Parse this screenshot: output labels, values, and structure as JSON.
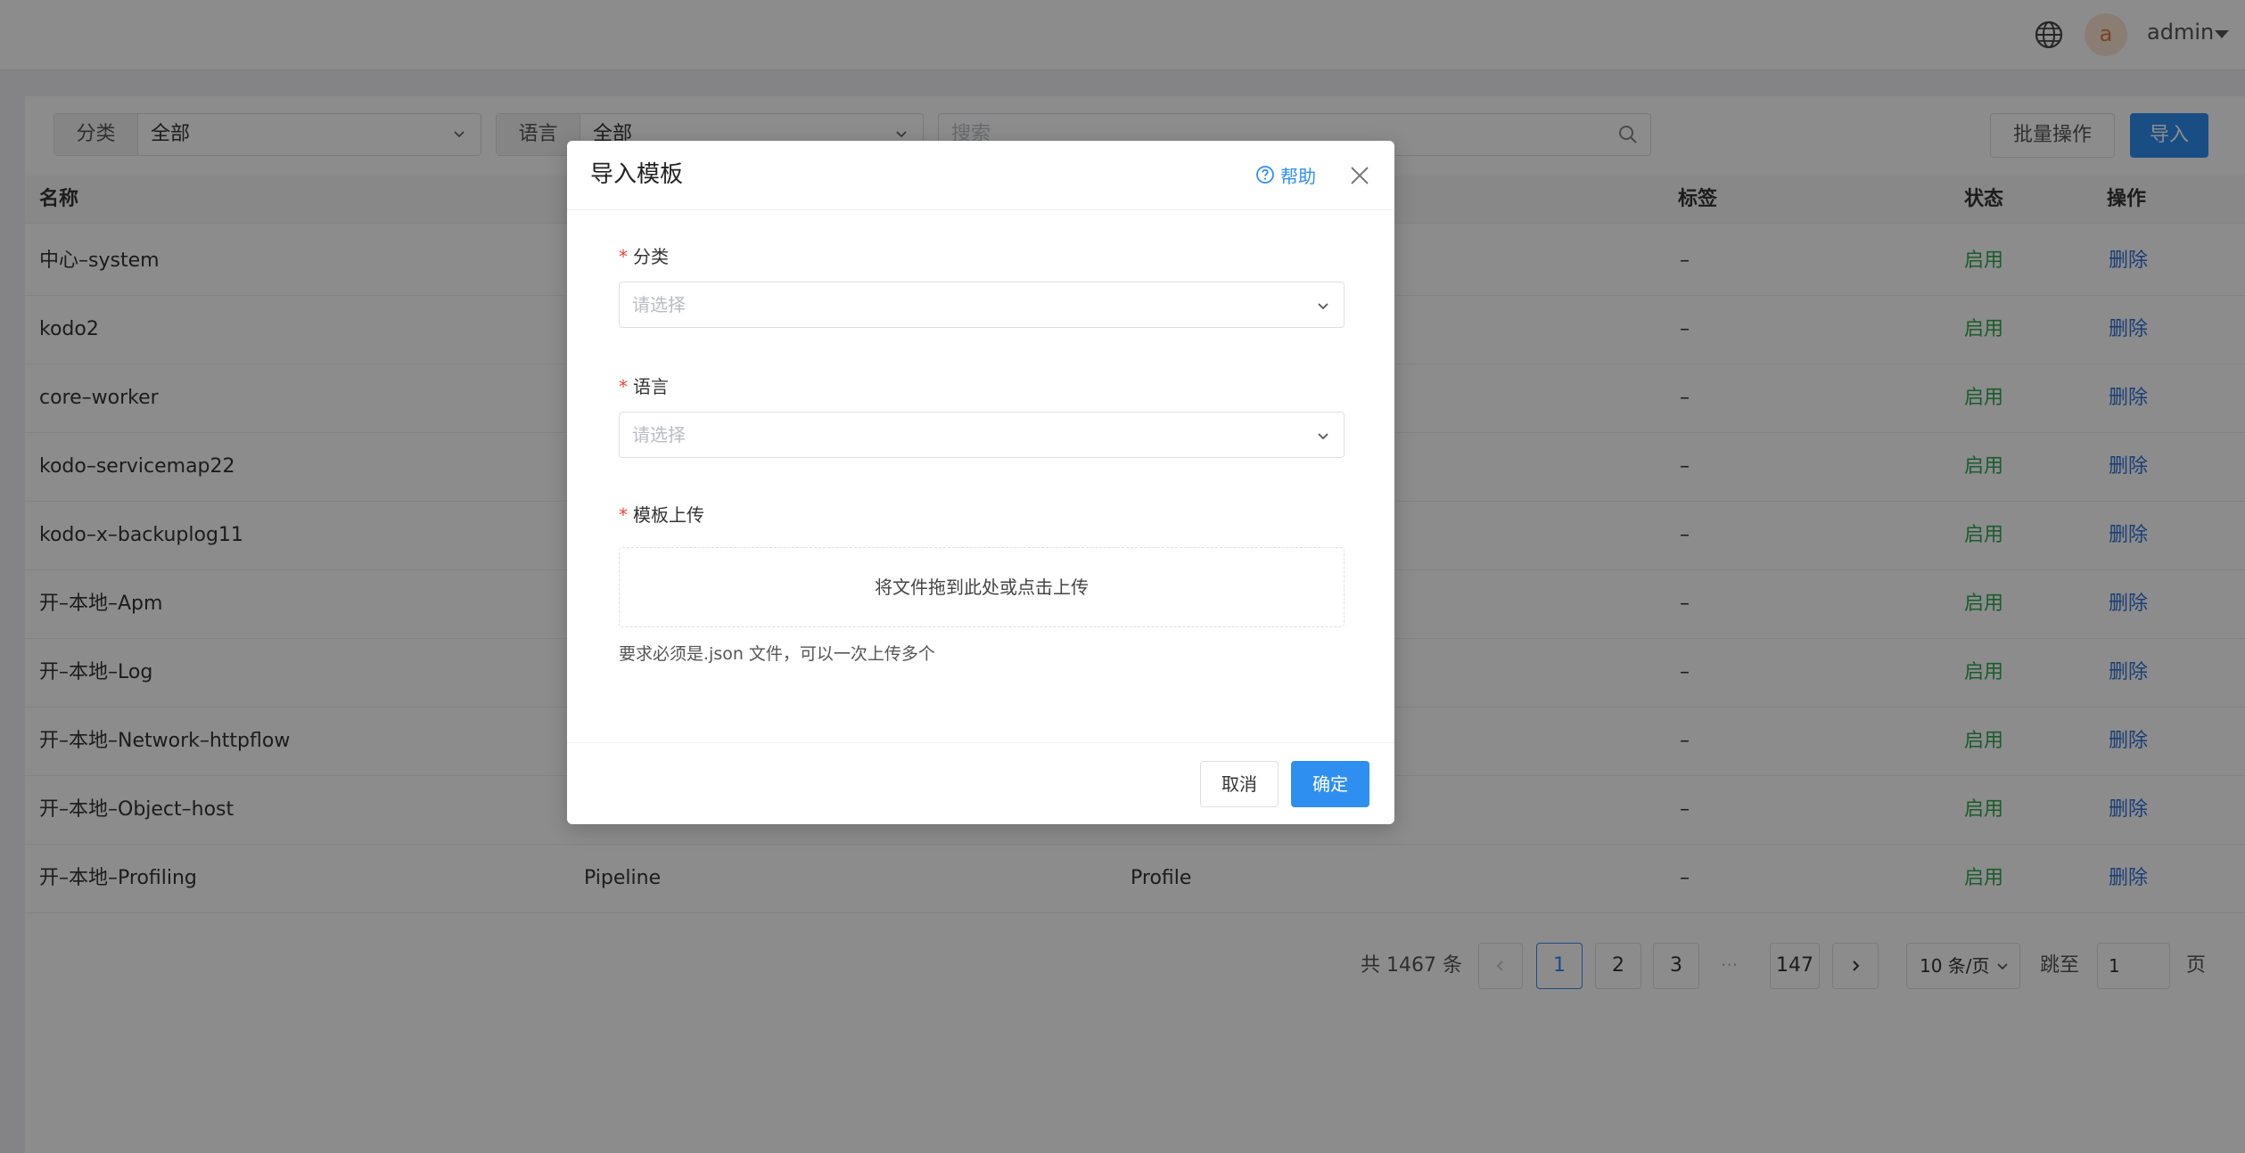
{
  "topbar": {
    "user_initial": "a",
    "username": "admin"
  },
  "filters": {
    "category": {
      "label": "分类",
      "value": "全部"
    },
    "language": {
      "label": "语言",
      "value": "全部"
    },
    "search_placeholder": "搜索"
  },
  "toolbar": {
    "batch_label": "批量操作",
    "import_label": "导入"
  },
  "table": {
    "columns": [
      "名称",
      "标签",
      "状态",
      "操作"
    ],
    "rows": [
      {
        "name": "中心–system",
        "col2": "",
        "col3": "",
        "tag": "–",
        "status": "启用",
        "action": "删除"
      },
      {
        "name": "kodo2",
        "col2": "",
        "col3": "",
        "tag": "–",
        "status": "启用",
        "action": "删除"
      },
      {
        "name": "core–worker",
        "col2": "",
        "col3": "",
        "tag": "–",
        "status": "启用",
        "action": "删除"
      },
      {
        "name": "kodo–servicemap22",
        "col2": "",
        "col3": "",
        "tag": "–",
        "status": "启用",
        "action": "删除"
      },
      {
        "name": "kodo–x–backuplog11",
        "col2": "",
        "col3": "",
        "tag": "–",
        "status": "启用",
        "action": "删除"
      },
      {
        "name": "开–本地–Apm",
        "col2": "",
        "col3": "",
        "tag": "–",
        "status": "启用",
        "action": "删除"
      },
      {
        "name": "开–本地–Log",
        "col2": "",
        "col3": "",
        "tag": "–",
        "status": "启用",
        "action": "删除"
      },
      {
        "name": "开–本地–Network–httpflow",
        "col2": "",
        "col3": "",
        "tag": "–",
        "status": "启用",
        "action": "删除"
      },
      {
        "name": "开–本地–Object–host",
        "col2": "",
        "col3": "",
        "tag": "–",
        "status": "启用",
        "action": "删除"
      },
      {
        "name": "开–本地–Profiling",
        "col2": "Pipeline",
        "col3": "Profile",
        "tag": "–",
        "status": "启用",
        "action": "删除"
      }
    ]
  },
  "pagination": {
    "total": "共 1467 条",
    "pages": [
      "1",
      "2",
      "3"
    ],
    "ellipsis": "···",
    "last": "147",
    "page_size": "10 条/页",
    "jump_label": "跳至",
    "jump_value": "1",
    "page_suffix": "页",
    "current": 1
  },
  "modal": {
    "title": "导入模板",
    "help": "帮助",
    "category_label": "分类",
    "category_placeholder": "请选择",
    "language_label": "语言",
    "language_placeholder": "请选择",
    "upload_label": "模板上传",
    "upload_text": "将文件拖到此处或点击上传",
    "hint": "要求必须是.json 文件，可以一次上传多个",
    "cancel": "取消",
    "ok": "确定"
  },
  "colors": {
    "primary": "#2f8ff0",
    "status_on": "#2fa84f",
    "action": "#2f6fd8",
    "required": "#f04134"
  },
  "icons": [
    "globe-icon",
    "caret-down-icon",
    "chevron-down-icon",
    "search-icon",
    "help-circle-icon",
    "close-icon",
    "chevron-left-icon",
    "chevron-right-icon"
  ]
}
